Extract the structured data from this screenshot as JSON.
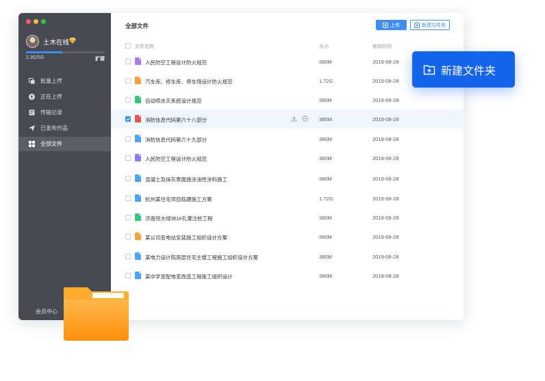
{
  "sidebar": {
    "username": "土木在线",
    "storage_text": "2.3G/5G",
    "storage_fraction": 0.46,
    "expand_label": "扩容",
    "nav": [
      {
        "label": "批量上传",
        "icon": "batch-upload-icon"
      },
      {
        "label": "正在上传",
        "icon": "uploading-icon"
      },
      {
        "label": "传输记录",
        "icon": "transfer-record-icon"
      },
      {
        "label": "已发布作品",
        "icon": "send-icon"
      },
      {
        "label": "全部文件",
        "icon": "grid-icon",
        "active": true
      }
    ],
    "member_center": "会员中心"
  },
  "main": {
    "title": "全部文件",
    "upload_label": "上传",
    "new_folder_label": "新建文件夹",
    "columns": {
      "name": "文件名称",
      "size": "大小",
      "modified": "修改时间"
    },
    "files": [
      {
        "name": "人民防空工程设计防火规范",
        "size": "380M",
        "date": "2019-08-28",
        "type": "word",
        "color": "#a77bf3"
      },
      {
        "name": "汽车库、修车库、停车场设计防火规范",
        "size": "1.72G",
        "date": "2019-08-28",
        "type": "ppt",
        "color": "#f6a23c"
      },
      {
        "name": "自动喷水灭系统设计规范",
        "size": "380M",
        "date": "2019-08-28",
        "type": "excel",
        "color": "#3cc27a"
      },
      {
        "name": "消防信息代码第六十八部分",
        "size": "380M",
        "date": "2019-08-28",
        "type": "pdf",
        "color": "#ef5350",
        "selected": true
      },
      {
        "name": "消防信息代码第六十九部分",
        "size": "380M",
        "date": "2019-08-28",
        "type": "doc",
        "color": "#4da3f5"
      },
      {
        "name": "人民防空工程设计防火规范",
        "size": "380M",
        "date": "2019-08-28",
        "type": "image",
        "color": "#8c7ef5"
      },
      {
        "name": "混凝土及抹灰表面施涂油性涂料施工",
        "size": "380M",
        "date": "2019-08-28",
        "type": "doc",
        "color": "#4da3f5"
      },
      {
        "name": "杭州某住宅项目临建施工方案",
        "size": "1.72G",
        "date": "2019-08-28",
        "type": "doc",
        "color": "#4da3f5"
      },
      {
        "name": "济南恒大绿洲1#孔灌注桩工程",
        "size": "380M",
        "date": "2019-08-28",
        "type": "excel",
        "color": "#3cc27a"
      },
      {
        "name": "某公司变电站安装施工组织设计方案",
        "size": "380M",
        "date": "2019-08-28",
        "type": "ppt",
        "color": "#f6a23c"
      },
      {
        "name": "某电力设计院高层住宅主楼工程施工组织设计方案",
        "size": "380M",
        "date": "2019-08-28",
        "type": "word",
        "color": "#4da3f5"
      },
      {
        "name": "某中学变配电室改造工程施工组织设计",
        "size": "380M",
        "date": "2019-08-28",
        "type": "doc",
        "color": "#4da3f5"
      }
    ]
  },
  "callout": {
    "label": "新建文件夹"
  },
  "colors": {
    "accent": "#3d8ef0",
    "sidebar": "#474a52",
    "callout": "#1364e9",
    "folder": "#ff9e1b"
  }
}
